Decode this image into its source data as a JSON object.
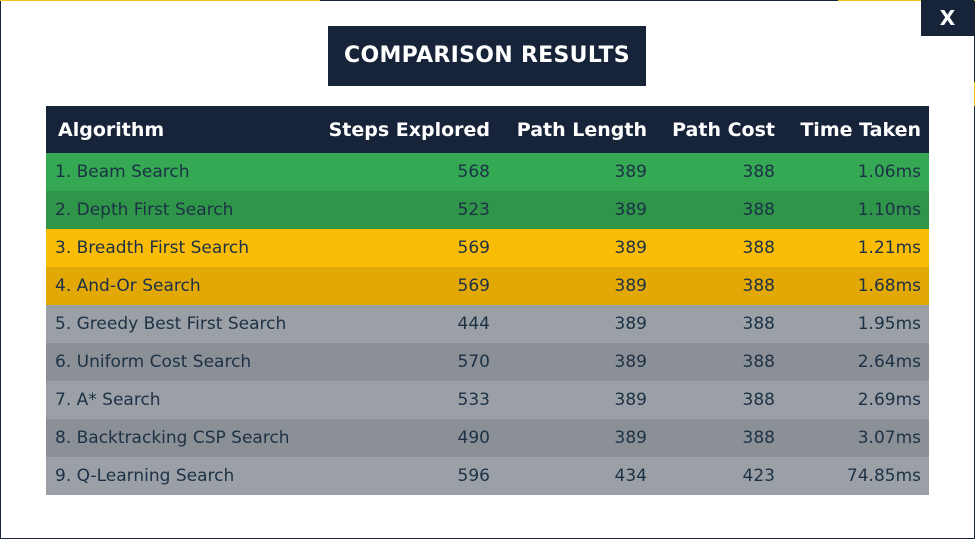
{
  "colors": {
    "background": "#162338",
    "accent": "#f5c11d",
    "dialog": "#ffffff",
    "header": "#162338",
    "row_text": "#1d3146"
  },
  "close_label": "X",
  "title": "COMPARISON RESULTS",
  "columns": [
    "Algorithm",
    "Steps Explored",
    "Path Length",
    "Path Cost",
    "Time Taken"
  ],
  "rows": [
    {
      "cells": [
        "1. Beam Search",
        "568",
        "389",
        "388",
        "1.06ms"
      ],
      "bg": "#34a853"
    },
    {
      "cells": [
        "2. Depth First Search",
        "523",
        "389",
        "388",
        "1.10ms"
      ],
      "bg": "#2e9549"
    },
    {
      "cells": [
        "3. Breadth First Search",
        "569",
        "389",
        "388",
        "1.21ms"
      ],
      "bg": "#fbbc05"
    },
    {
      "cells": [
        "4. And-Or Search",
        "569",
        "389",
        "388",
        "1.68ms"
      ],
      "bg": "#e2a805"
    },
    {
      "cells": [
        "5. Greedy Best First Search",
        "444",
        "389",
        "388",
        "1.95ms"
      ],
      "bg": "#9aa0a6"
    },
    {
      "cells": [
        "6. Uniform Cost Search",
        "570",
        "389",
        "388",
        "2.64ms"
      ],
      "bg": "#8a9096"
    },
    {
      "cells": [
        "7. A* Search",
        "533",
        "389",
        "388",
        "2.69ms"
      ],
      "bg": "#9aa0a6"
    },
    {
      "cells": [
        "8. Backtracking CSP Search",
        "490",
        "389",
        "388",
        "3.07ms"
      ],
      "bg": "#8a9096"
    },
    {
      "cells": [
        "9. Q-Learning Search",
        "596",
        "434",
        "423",
        "74.85ms"
      ],
      "bg": "#9aa0a6"
    }
  ]
}
